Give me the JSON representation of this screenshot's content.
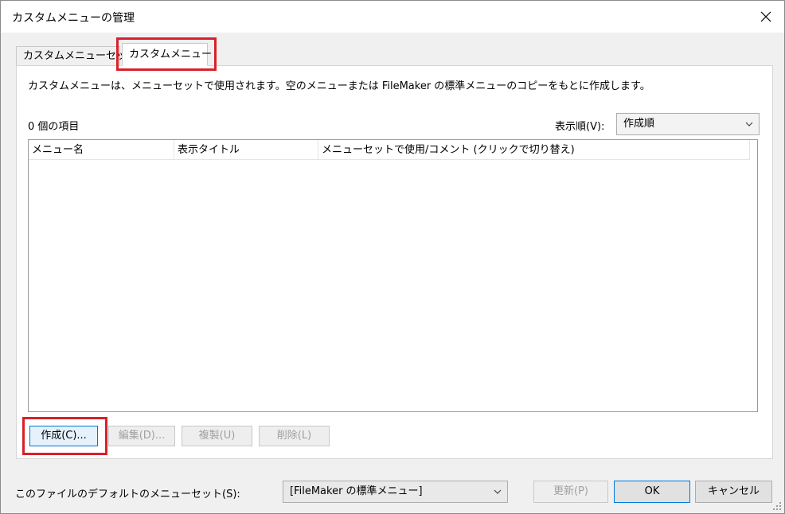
{
  "window": {
    "title": "カスタムメニューの管理"
  },
  "tabs": [
    {
      "label": "カスタムメニューセット",
      "active": false
    },
    {
      "label": "カスタムメニュー",
      "active": true
    }
  ],
  "panel": {
    "description": "カスタムメニューは、メニューセットで使用されます。空のメニューまたは FileMaker の標準メニューのコピーをもとに作成します。",
    "item_count": "0 個の項目",
    "sort": {
      "label": "表示順(V):",
      "selected": "作成順"
    },
    "list": {
      "columns": [
        "メニュー名",
        "表示タイトル",
        "メニューセットで使用/コメント (クリックで切り替え)"
      ],
      "rows": []
    },
    "buttons": {
      "create": "作成(C)...",
      "edit": "編集(D)...",
      "duplicate": "複製(U)",
      "delete": "削除(L)"
    }
  },
  "footer": {
    "default_label": "このファイルのデフォルトのメニューセット(S):",
    "default_selected": "[FileMaker の標準メニュー]",
    "update": "更新(P)",
    "ok": "OK",
    "cancel": "キャンセル"
  },
  "colors": {
    "highlight": "#d9202a",
    "focus_border": "#0078d7"
  }
}
